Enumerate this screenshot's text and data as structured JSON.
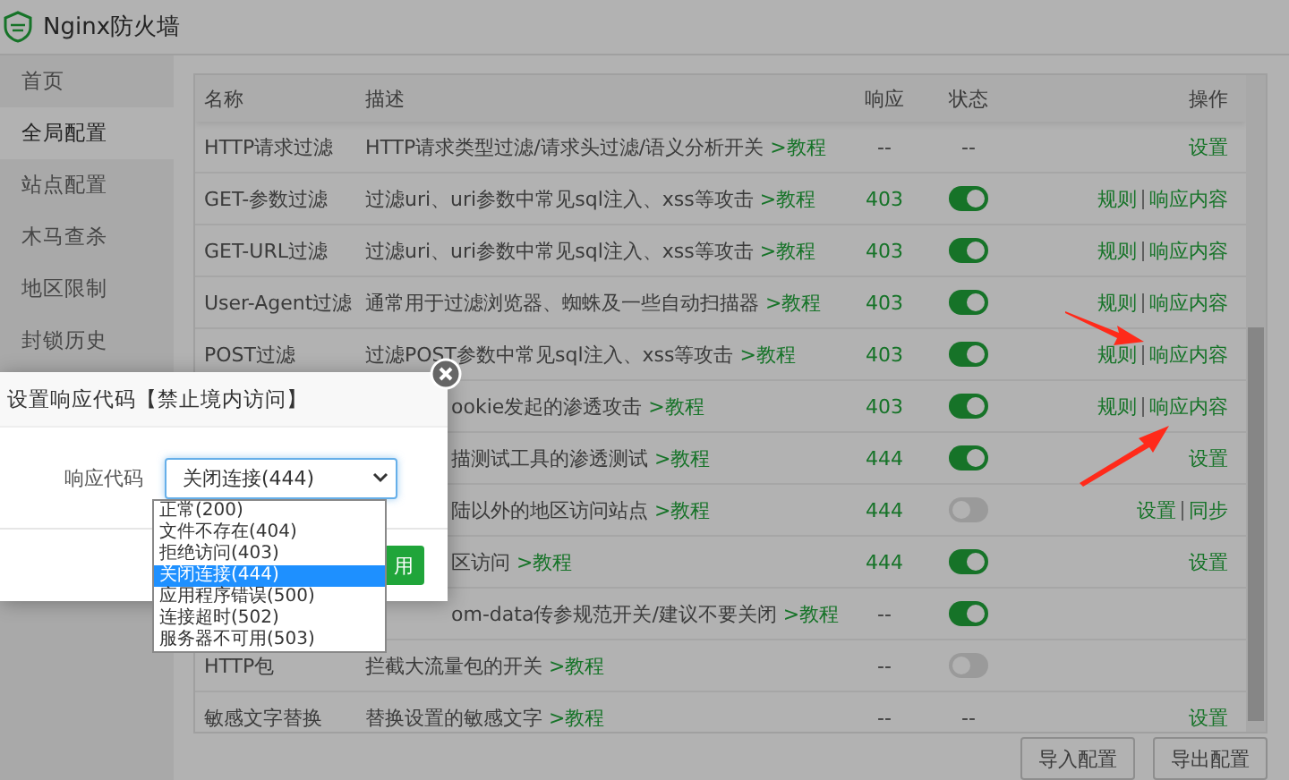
{
  "window": {
    "title": "Nginx防火墙"
  },
  "sidebar": {
    "items": [
      {
        "label": "首页",
        "selected": false
      },
      {
        "label": "全局配置",
        "selected": true
      },
      {
        "label": "站点配置",
        "selected": false
      },
      {
        "label": "木马查杀",
        "selected": false
      },
      {
        "label": "地区限制",
        "selected": false
      },
      {
        "label": "封锁历史",
        "selected": false
      }
    ]
  },
  "table": {
    "columns": [
      "名称",
      "描述",
      "响应",
      "状态",
      "操作"
    ],
    "rows": [
      {
        "kind": "full",
        "name": "HTTP请求过滤",
        "desc": "HTTP请求类型过滤/请求头过滤/语义分析开关",
        "link": ">教程",
        "response": "--",
        "status": {
          "kind": "text",
          "text": "--"
        },
        "actions": [
          "设置"
        ]
      },
      {
        "kind": "full",
        "name": "GET-参数过滤",
        "desc": "过滤uri、uri参数中常见sql注入、xss等攻击",
        "link": ">教程",
        "response": "403",
        "status": {
          "kind": "switch",
          "on": true
        },
        "actions": [
          "规则",
          "响应内容"
        ]
      },
      {
        "kind": "full",
        "name": "GET-URL过滤",
        "desc": "过滤uri、uri参数中常见sql注入、xss等攻击",
        "link": ">教程",
        "response": "403",
        "status": {
          "kind": "switch",
          "on": true
        },
        "actions": [
          "规则",
          "响应内容"
        ]
      },
      {
        "kind": "full",
        "name": "User-Agent过滤",
        "desc": "通常用于过滤浏览器、蜘蛛及一些自动扫描器",
        "link": ">教程",
        "response": "403",
        "status": {
          "kind": "switch",
          "on": true
        },
        "actions": [
          "规则",
          "响应内容"
        ]
      },
      {
        "kind": "full",
        "name": "POST过滤",
        "desc": "过滤POST参数中常见sql注入、xss等攻击",
        "link": ">教程",
        "response": "403",
        "status": {
          "kind": "switch",
          "on": true
        },
        "actions": [
          "规则",
          "响应内容"
        ]
      },
      {
        "kind": "covered",
        "desc": "ookie发起的渗透攻击",
        "link": ">教程",
        "response": "403",
        "status": {
          "kind": "switch",
          "on": true
        },
        "actions": [
          "规则",
          "响应内容"
        ]
      },
      {
        "kind": "covered",
        "desc": "描测试工具的渗透测试",
        "link": ">教程",
        "response": "444",
        "status": {
          "kind": "switch",
          "on": true
        },
        "actions": [
          "设置"
        ]
      },
      {
        "kind": "covered",
        "desc": "陆以外的地区访问站点",
        "link": ">教程",
        "response": "444",
        "status": {
          "kind": "switch",
          "on": false
        },
        "actions": [
          "设置",
          "同步"
        ]
      },
      {
        "kind": "covered",
        "desc": "区访问",
        "link": ">教程",
        "response": "444",
        "status": {
          "kind": "switch",
          "on": true
        },
        "actions": [
          "设置"
        ]
      },
      {
        "kind": "covered",
        "desc": "om-data传参规范开关/建议不要关闭",
        "link": ">教程",
        "response": "--",
        "status": {
          "kind": "switch",
          "on": true
        },
        "actions": []
      },
      {
        "kind": "full",
        "name": "HTTP包",
        "desc": "拦截大流量包的开关",
        "link": ">教程",
        "response": "--",
        "status": {
          "kind": "switch",
          "on": false
        },
        "actions": []
      },
      {
        "kind": "full",
        "name": "敏感文字替换",
        "desc": "替换设置的敏感文字",
        "link": ">教程",
        "response": "--",
        "status": {
          "kind": "text",
          "text": "--"
        },
        "actions": [
          "设置"
        ]
      }
    ]
  },
  "buttons": [
    "导入配置",
    "导出配置"
  ],
  "dialog": {
    "title": "设置响应代码【禁止境内访问】",
    "field_label": "响应代码",
    "select": {
      "value": "关闭连接(444)",
      "options": [
        {
          "label": "正常(200)",
          "selected": false
        },
        {
          "label": "文件不存在(404)",
          "selected": false
        },
        {
          "label": "拒绝访问(403)",
          "selected": false
        },
        {
          "label": "关闭连接(444)",
          "selected": true
        },
        {
          "label": "应用程序错误(500)",
          "selected": false
        },
        {
          "label": "连接超时(502)",
          "selected": false
        },
        {
          "label": "服务器不可用(503)",
          "selected": false
        }
      ]
    },
    "apply_button": "用"
  }
}
